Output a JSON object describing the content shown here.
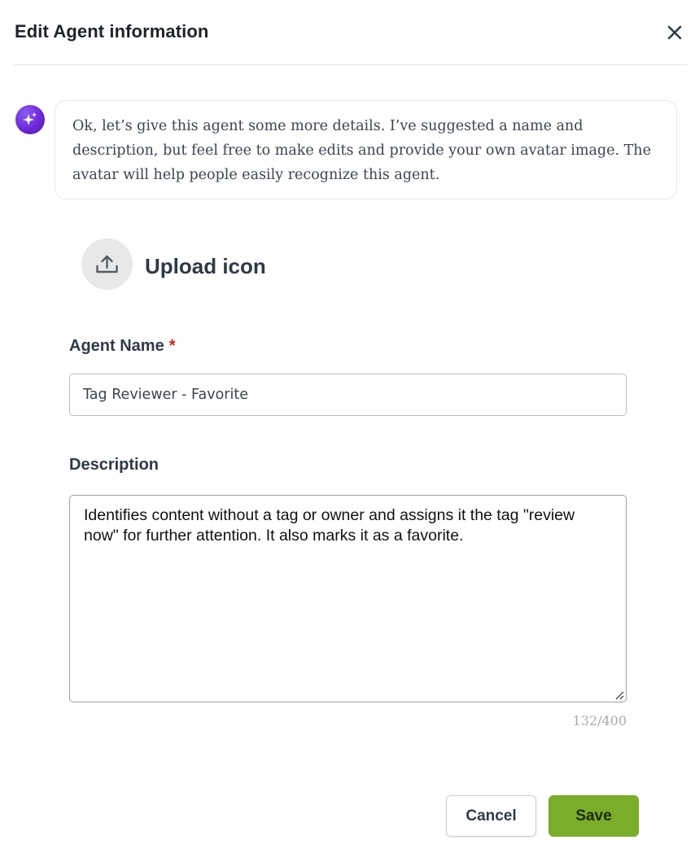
{
  "dialog": {
    "title": "Edit Agent information",
    "close_icon": "close-icon"
  },
  "assistant": {
    "avatar_icon": "sparkle-icon",
    "message": "Ok, let’s give this agent some more details. I’ve suggested a name and description, but feel free to make edits and provide your own avatar image. The avatar will help people easily recognize this agent."
  },
  "upload": {
    "icon": "upload-icon",
    "label": "Upload icon"
  },
  "agent_name": {
    "label": "Agent Name",
    "required_marker": "*",
    "value": "Tag Reviewer - Favorite"
  },
  "description": {
    "label": "Description",
    "value": "Identifies content without a tag or owner and assigns it the tag \"review now\" for further attention. It also marks it as a favorite.",
    "char_count": "132/400"
  },
  "actions": {
    "cancel_label": "Cancel",
    "save_label": "Save"
  },
  "colors": {
    "accent_save": "#7aad28",
    "required": "#d0201f",
    "assistant_avatar": "#6d28d9"
  }
}
